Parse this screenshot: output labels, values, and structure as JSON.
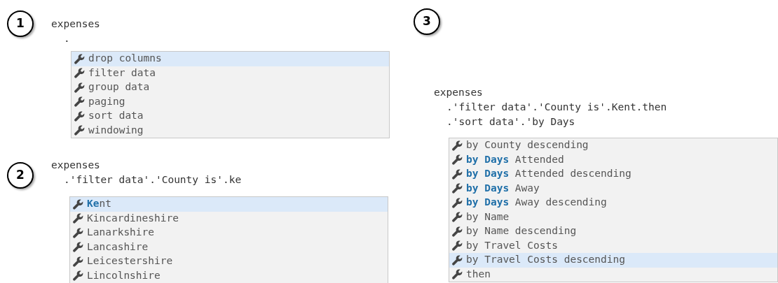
{
  "panels": [
    {
      "number": "1",
      "code": [
        "expenses",
        "."
      ],
      "suggestions": [
        {
          "label": "drop columns",
          "selected": true
        },
        {
          "label": "filter data",
          "selected": false
        },
        {
          "label": "group data",
          "selected": false
        },
        {
          "label": "paging",
          "selected": false
        },
        {
          "label": "sort data",
          "selected": false
        },
        {
          "label": "windowing",
          "selected": false
        }
      ]
    },
    {
      "number": "2",
      "code": [
        "expenses",
        ".'filter data'.'County is'.ke"
      ],
      "suggestions": [
        {
          "label": "**Ke**nt",
          "selected": true
        },
        {
          "label": "Kincardineshire",
          "selected": false
        },
        {
          "label": "Lanarkshire",
          "selected": false
        },
        {
          "label": "Lancashire",
          "selected": false
        },
        {
          "label": "Leicestershire",
          "selected": false
        },
        {
          "label": "Lincolnshire",
          "selected": false
        }
      ]
    },
    {
      "number": "3",
      "code": [
        "expenses",
        ".'filter data'.'County is'.Kent.then",
        ".'sort data'.'by Days"
      ],
      "suggestions": [
        {
          "label": "by County descending",
          "selected": false
        },
        {
          "label": "**by Days** Attended",
          "selected": false
        },
        {
          "label": "**by Days** Attended descending",
          "selected": false
        },
        {
          "label": "**by Days** Away",
          "selected": false
        },
        {
          "label": "**by Days** Away descending",
          "selected": false
        },
        {
          "label": "by Name",
          "selected": false
        },
        {
          "label": "by Name descending",
          "selected": false
        },
        {
          "label": "by Travel Costs",
          "selected": false
        },
        {
          "label": "by Travel Costs descending",
          "selected": true
        },
        {
          "label": "then",
          "selected": false
        }
      ]
    }
  ]
}
